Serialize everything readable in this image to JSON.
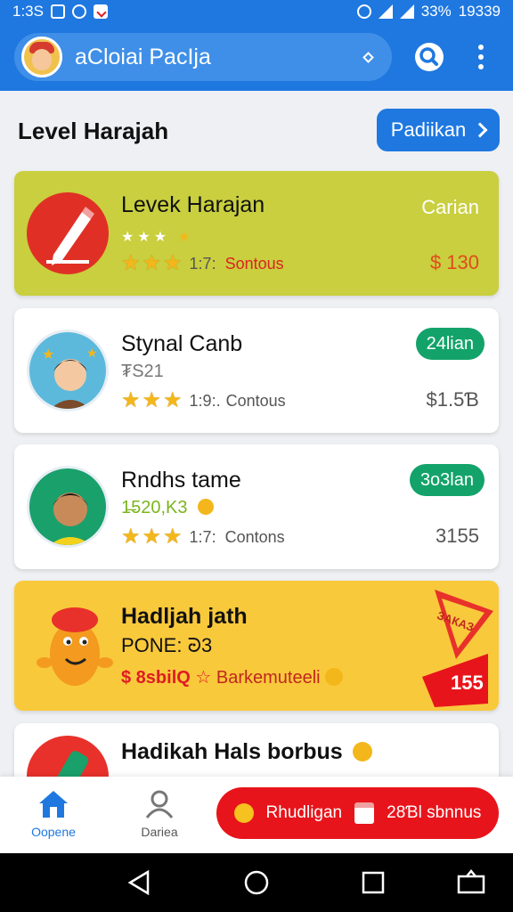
{
  "status_bar": {
    "time": "1:3S",
    "battery": "33%",
    "clock_right": "19339"
  },
  "app_bar": {
    "search_text": "aCloiai PacIja"
  },
  "header": {
    "section_title": "Level Harajah",
    "action_label": "Padiikan"
  },
  "cards": [
    {
      "title": "Levek Harajan",
      "tag": "Carian",
      "rating": "1:7:",
      "rating_label": "Sontous",
      "price": "$ 130"
    },
    {
      "title": "Stynal Canb",
      "subtitle": "₮S21",
      "rating": "1:9:.",
      "rating_label": "Contous",
      "price": "$1.5Ɓ",
      "tag": "24lian"
    },
    {
      "title": "Rndhs tame",
      "subtitle": "1̶520,K3",
      "rating": "1:7:",
      "rating_label": "Contons",
      "price": "3155",
      "tag": "3o3lan"
    },
    {
      "title": "Hadljah jath",
      "subtitle": "PONE: ᘒ3",
      "promo": "$ 8sbilQ",
      "promo_label": "Barkemuteeli",
      "badge": "ЗАКАЗ",
      "badge_value": "155"
    },
    {
      "title": "Hadikah Hals borbus"
    }
  ],
  "bottom_nav": {
    "home_label": "Oopene",
    "profile_label": "Dariea",
    "cta_left": "Rhudligan",
    "cta_right": "28Ɓl sbnnus"
  },
  "colors": {
    "primary": "#1f78e0",
    "green_card": "#c9cf3e",
    "yellow_card": "#f9c93c",
    "pill_green": "#13a36a",
    "cta_red": "#e8141b"
  }
}
